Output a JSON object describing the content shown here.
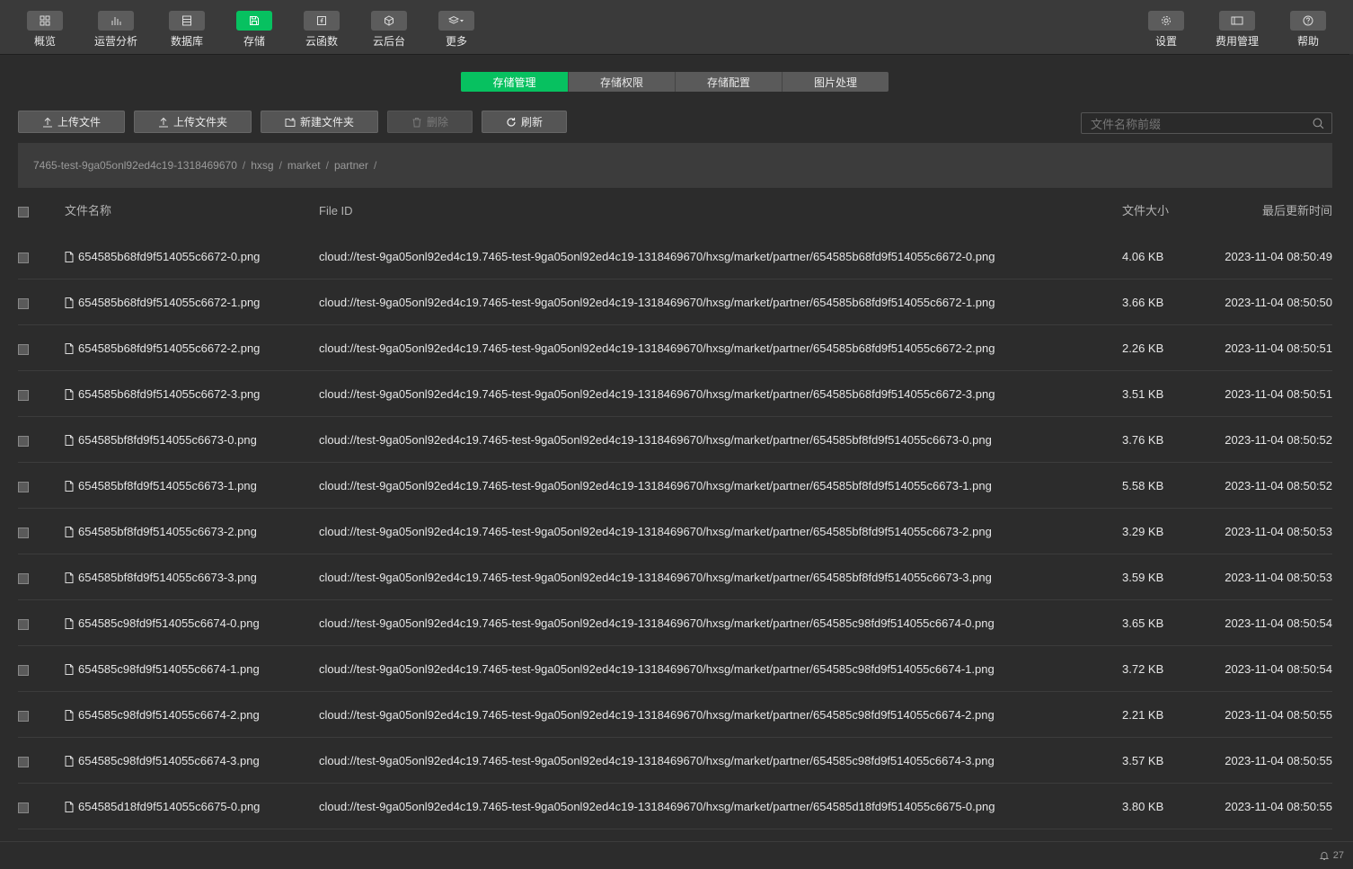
{
  "topnav": {
    "left": [
      {
        "label": "概览",
        "icon": "grid-icon"
      },
      {
        "label": "运营分析",
        "icon": "bar-chart-icon"
      },
      {
        "label": "数据库",
        "icon": "database-icon"
      },
      {
        "label": "存储",
        "icon": "save-icon",
        "active": true
      },
      {
        "label": "云函数",
        "icon": "function-icon"
      },
      {
        "label": "云后台",
        "icon": "cube-icon"
      },
      {
        "label": "更多",
        "icon": "layers-icon"
      }
    ],
    "right": [
      {
        "label": "设置",
        "icon": "gear-icon"
      },
      {
        "label": "费用管理",
        "icon": "wallet-icon"
      },
      {
        "label": "帮助",
        "icon": "help-icon"
      }
    ]
  },
  "tabs": [
    "存储管理",
    "存储权限",
    "存储配置",
    "图片处理"
  ],
  "toolbar": {
    "upload_file": "上传文件",
    "upload_folder": "上传文件夹",
    "new_folder": "新建文件夹",
    "delete": "删除",
    "refresh": "刷新"
  },
  "search": {
    "placeholder": "文件名称前缀"
  },
  "breadcrumb": [
    "7465-test-9ga05onl92ed4c19-1318469670",
    "hxsg",
    "market",
    "partner"
  ],
  "table": {
    "headers": {
      "name": "文件名称",
      "file_id": "File ID",
      "size": "文件大小",
      "updated": "最后更新时间"
    },
    "rows": [
      {
        "name": "654585b68fd9f514055c6672-0.png",
        "file_id": "cloud://test-9ga05onl92ed4c19.7465-test-9ga05onl92ed4c19-1318469670/hxsg/market/partner/654585b68fd9f514055c6672-0.png",
        "size": "4.06 KB",
        "updated": "2023-11-04 08:50:49"
      },
      {
        "name": "654585b68fd9f514055c6672-1.png",
        "file_id": "cloud://test-9ga05onl92ed4c19.7465-test-9ga05onl92ed4c19-1318469670/hxsg/market/partner/654585b68fd9f514055c6672-1.png",
        "size": "3.66 KB",
        "updated": "2023-11-04 08:50:50"
      },
      {
        "name": "654585b68fd9f514055c6672-2.png",
        "file_id": "cloud://test-9ga05onl92ed4c19.7465-test-9ga05onl92ed4c19-1318469670/hxsg/market/partner/654585b68fd9f514055c6672-2.png",
        "size": "2.26 KB",
        "updated": "2023-11-04 08:50:51"
      },
      {
        "name": "654585b68fd9f514055c6672-3.png",
        "file_id": "cloud://test-9ga05onl92ed4c19.7465-test-9ga05onl92ed4c19-1318469670/hxsg/market/partner/654585b68fd9f514055c6672-3.png",
        "size": "3.51 KB",
        "updated": "2023-11-04 08:50:51"
      },
      {
        "name": "654585bf8fd9f514055c6673-0.png",
        "file_id": "cloud://test-9ga05onl92ed4c19.7465-test-9ga05onl92ed4c19-1318469670/hxsg/market/partner/654585bf8fd9f514055c6673-0.png",
        "size": "3.76 KB",
        "updated": "2023-11-04 08:50:52"
      },
      {
        "name": "654585bf8fd9f514055c6673-1.png",
        "file_id": "cloud://test-9ga05onl92ed4c19.7465-test-9ga05onl92ed4c19-1318469670/hxsg/market/partner/654585bf8fd9f514055c6673-1.png",
        "size": "5.58 KB",
        "updated": "2023-11-04 08:50:52"
      },
      {
        "name": "654585bf8fd9f514055c6673-2.png",
        "file_id": "cloud://test-9ga05onl92ed4c19.7465-test-9ga05onl92ed4c19-1318469670/hxsg/market/partner/654585bf8fd9f514055c6673-2.png",
        "size": "3.29 KB",
        "updated": "2023-11-04 08:50:53"
      },
      {
        "name": "654585bf8fd9f514055c6673-3.png",
        "file_id": "cloud://test-9ga05onl92ed4c19.7465-test-9ga05onl92ed4c19-1318469670/hxsg/market/partner/654585bf8fd9f514055c6673-3.png",
        "size": "3.59 KB",
        "updated": "2023-11-04 08:50:53"
      },
      {
        "name": "654585c98fd9f514055c6674-0.png",
        "file_id": "cloud://test-9ga05onl92ed4c19.7465-test-9ga05onl92ed4c19-1318469670/hxsg/market/partner/654585c98fd9f514055c6674-0.png",
        "size": "3.65 KB",
        "updated": "2023-11-04 08:50:54"
      },
      {
        "name": "654585c98fd9f514055c6674-1.png",
        "file_id": "cloud://test-9ga05onl92ed4c19.7465-test-9ga05onl92ed4c19-1318469670/hxsg/market/partner/654585c98fd9f514055c6674-1.png",
        "size": "3.72 KB",
        "updated": "2023-11-04 08:50:54"
      },
      {
        "name": "654585c98fd9f514055c6674-2.png",
        "file_id": "cloud://test-9ga05onl92ed4c19.7465-test-9ga05onl92ed4c19-1318469670/hxsg/market/partner/654585c98fd9f514055c6674-2.png",
        "size": "2.21 KB",
        "updated": "2023-11-04 08:50:55"
      },
      {
        "name": "654585c98fd9f514055c6674-3.png",
        "file_id": "cloud://test-9ga05onl92ed4c19.7465-test-9ga05onl92ed4c19-1318469670/hxsg/market/partner/654585c98fd9f514055c6674-3.png",
        "size": "3.57 KB",
        "updated": "2023-11-04 08:50:55"
      },
      {
        "name": "654585d18fd9f514055c6675-0.png",
        "file_id": "cloud://test-9ga05onl92ed4c19.7465-test-9ga05onl92ed4c19-1318469670/hxsg/market/partner/654585d18fd9f514055c6675-0.png",
        "size": "3.80 KB",
        "updated": "2023-11-04 08:50:55"
      }
    ]
  },
  "footer": {
    "notification_count": "27"
  },
  "colors": {
    "accent": "#07c160",
    "background": "#2c2c2c",
    "topbar": "#3a3a3a"
  }
}
